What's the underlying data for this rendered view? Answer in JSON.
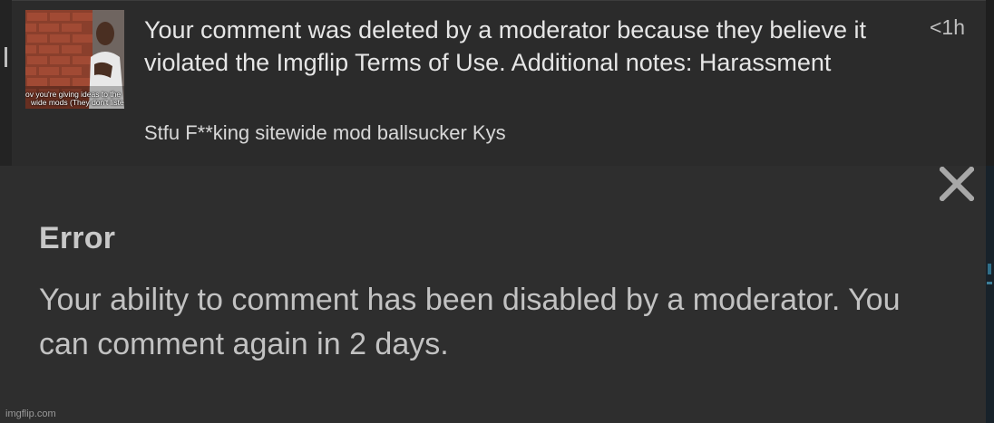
{
  "notification": {
    "thumbnail_caption_line1": "ov you're giving ideas to the",
    "thumbnail_caption_line2": "wide mods (They don't liste",
    "message": "Your comment was deleted by a moderator because they believe it violated the Imgflip Terms of Use. Additional notes: Harassment",
    "time": "<1h",
    "comment_text": "Stfu F**king sitewide mod ballsucker Kys"
  },
  "dialog": {
    "close_icon": "close-icon",
    "title": "Error",
    "message": "Your ability to comment has been disabled by a moderator. You can comment again in 2 days."
  },
  "watermark": "imgflip.com",
  "colors": {
    "panel_bg": "#2b2b2b",
    "dialog_bg": "#2e2e2e",
    "text_primary": "#e6e6e6",
    "text_dialog": "#c2c2c2"
  }
}
